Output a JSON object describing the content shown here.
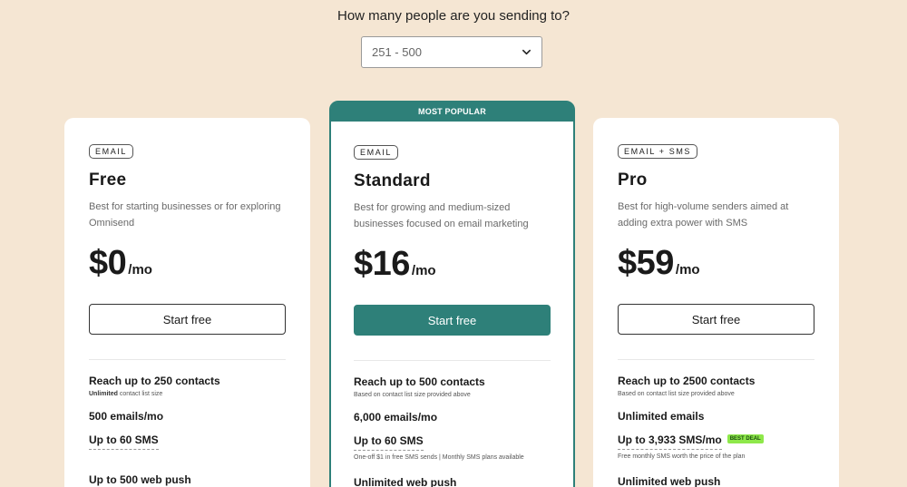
{
  "header": {
    "question": "How many people are you sending to?",
    "select_value": "251 - 500"
  },
  "plans": [
    {
      "badge": "EMAIL",
      "name": "Free",
      "desc": "Best for starting businesses or for exploring Omnisend",
      "price": "$0",
      "per": "/mo",
      "button": "Start free",
      "contacts": "Reach up to 250 contacts",
      "contacts_sub_bold": "Unlimited",
      "contacts_sub": " contact list size",
      "emails": "500 emails/mo",
      "sms": "Up to 60 SMS",
      "push": "Up to 500 web push"
    },
    {
      "ribbon": "MOST POPULAR",
      "badge": "EMAIL",
      "name": "Standard",
      "desc": "Best for growing and medium-sized businesses focused on email marketing",
      "price": "$16",
      "per": "/mo",
      "button": "Start free",
      "contacts": "Reach up to 500 contacts",
      "contacts_sub": "Based on contact list size provided above",
      "emails": "6,000 emails/mo",
      "sms": "Up to 60 SMS",
      "sms_sub": "One-off $1 in free SMS sends | Monthly SMS plans available",
      "push": "Unlimited web push"
    },
    {
      "badge": "EMAIL + SMS",
      "name": "Pro",
      "desc": "Best for high-volume senders aimed at adding extra power with SMS",
      "price": "$59",
      "per": "/mo",
      "button": "Start free",
      "contacts": "Reach up to 2500 contacts",
      "contacts_sub": "Based on contact list size provided above",
      "emails": "Unlimited emails",
      "sms": "Up to 3,933 SMS/mo",
      "sms_badge": "BEST DEAL",
      "sms_sub": "Free monthly SMS worth the price of the plan",
      "push": "Unlimited web push"
    }
  ],
  "colors": {
    "background": "#f5e6d3",
    "accent": "#2e8079",
    "best_deal": "#8ee84a"
  },
  "icons": {
    "select_chevron": "chevron-down-icon"
  }
}
